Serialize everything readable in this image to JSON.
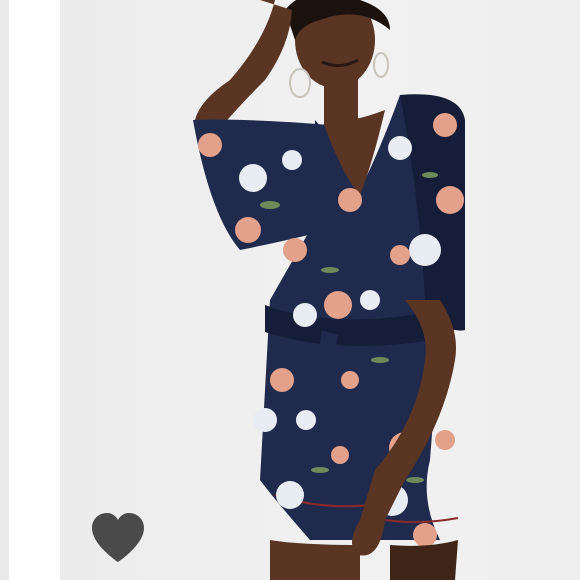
{
  "product_image": {
    "alt_subject": "model-in-floral-romper",
    "palette": {
      "background": "#efefef",
      "skin": "#5a3523",
      "skin_shadow": "#3f2418",
      "hair": "#1c120d",
      "garment": "#1f2a4d",
      "garment_dark": "#151d38",
      "flower_pink": "#e3a08a",
      "flower_white": "#e8ecf3",
      "leaf": "#6f8a5a",
      "piping": "#8a2a2a"
    }
  },
  "like_button": {
    "icon": "heart-icon",
    "color": "#4a4a4a"
  }
}
